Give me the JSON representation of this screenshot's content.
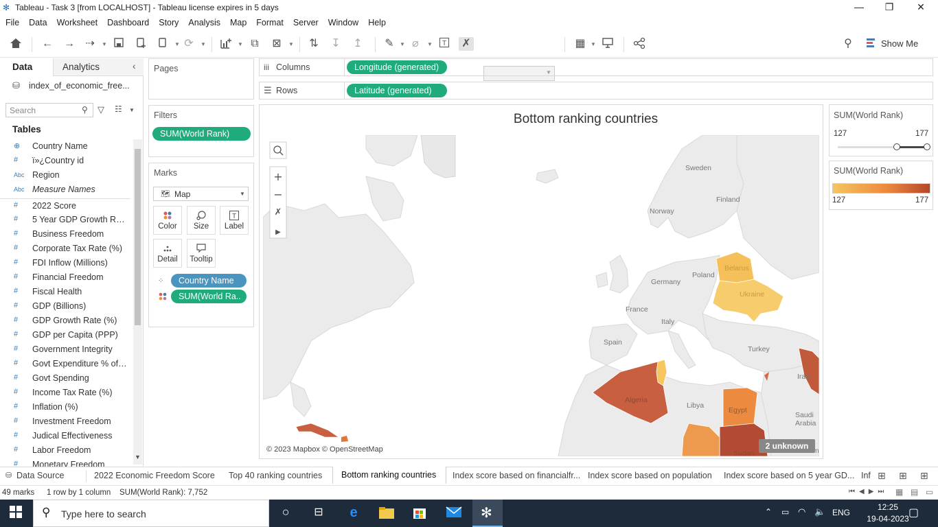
{
  "window": {
    "title": "Tableau - Task 3 [from LOCALHOST] - Tableau license expires in 5 days",
    "minimize": "—",
    "restore": "❐",
    "close": "✕"
  },
  "menu": [
    "File",
    "Data",
    "Worksheet",
    "Dashboard",
    "Story",
    "Analysis",
    "Map",
    "Format",
    "Server",
    "Window",
    "Help"
  ],
  "toolbar": {
    "show_me": "Show Me"
  },
  "left_pane": {
    "tab_data": "Data",
    "tab_analytics": "Analytics",
    "datasource": "index_of_economic_free...",
    "search_placeholder": "Search",
    "tables_heading": "Tables",
    "fields": [
      {
        "icon": "globe",
        "type": "geo",
        "name": "Country Name"
      },
      {
        "icon": "#",
        "type": "num",
        "name": "ï»¿Country id"
      },
      {
        "icon": "Abc",
        "type": "str",
        "name": "Region"
      },
      {
        "icon": "Abc",
        "type": "str",
        "name": "Measure Names",
        "italic": true
      },
      {
        "icon": "#",
        "type": "num",
        "name": "2022 Score"
      },
      {
        "icon": "#",
        "type": "num",
        "name": "5 Year GDP Growth Ra..."
      },
      {
        "icon": "#",
        "type": "num",
        "name": "Business Freedom"
      },
      {
        "icon": "#",
        "type": "num",
        "name": "Corporate Tax Rate (%)"
      },
      {
        "icon": "#",
        "type": "num",
        "name": "FDI Inflow (Millions)"
      },
      {
        "icon": "#",
        "type": "num",
        "name": "Financial Freedom"
      },
      {
        "icon": "#",
        "type": "num",
        "name": "Fiscal Health"
      },
      {
        "icon": "#",
        "type": "num",
        "name": "GDP (Billions)"
      },
      {
        "icon": "#",
        "type": "num",
        "name": "GDP Growth Rate (%)"
      },
      {
        "icon": "#",
        "type": "num",
        "name": "GDP per Capita (PPP)"
      },
      {
        "icon": "#",
        "type": "num",
        "name": "Government Integrity"
      },
      {
        "icon": "#",
        "type": "num",
        "name": "Govt Expenditure % of ..."
      },
      {
        "icon": "#",
        "type": "num",
        "name": "Govt Spending"
      },
      {
        "icon": "#",
        "type": "num",
        "name": "Income Tax Rate (%)"
      },
      {
        "icon": "#",
        "type": "num",
        "name": "Inflation (%)"
      },
      {
        "icon": "#",
        "type": "num",
        "name": "Investment Freedom"
      },
      {
        "icon": "#",
        "type": "num",
        "name": "Judical Effectiveness"
      },
      {
        "icon": "#",
        "type": "num",
        "name": "Labor Freedom"
      },
      {
        "icon": "#",
        "type": "num",
        "name": "Monetary Freedom"
      }
    ]
  },
  "shelves": {
    "pages": "Pages",
    "filters": "Filters",
    "filter_pill": "SUM(World Rank)",
    "marks": "Marks",
    "mark_type": "Map",
    "mark_buttons": [
      "Color",
      "Size",
      "Label",
      "Detail",
      "Tooltip"
    ],
    "mark_pills": [
      "Country Name",
      "SUM(World Ra.."
    ],
    "columns_label": "Columns",
    "columns_pill": "Longitude (generated)",
    "rows_label": "Rows",
    "rows_pill": "Latitude (generated)"
  },
  "view": {
    "title": "Bottom ranking countries",
    "attribution": "© 2023 Mapbox © OpenStreetMap",
    "unknown_badge": "2 unknown",
    "map_labels": [
      "Sweden",
      "Finland",
      "Norway",
      "Poland",
      "Germany",
      "France",
      "Italy",
      "Spain",
      "Turkey",
      "Iraq",
      "Libya",
      "Algeria",
      "Egypt",
      "Saudi Arabia",
      "Sudan",
      "Yeme",
      "Belarus",
      "Ukraine"
    ]
  },
  "legends": {
    "filter_title": "SUM(World Rank)",
    "filter_min": "127",
    "filter_max": "177",
    "color_title": "SUM(World Rank)",
    "color_min": "127",
    "color_max": "177",
    "color_low": "#f6c55e",
    "color_high": "#b5452a"
  },
  "sheet_tabs": {
    "data_source": "Data Source",
    "tabs": [
      "2022 Economic Freedom Score",
      "Top 40 ranking countries",
      "Bottom ranking countries",
      "Index score based on financialfr...",
      "Index score based on population",
      "Index score based on 5 year GD...",
      "Inf"
    ],
    "active": "Bottom ranking countries"
  },
  "status": {
    "marks": "49 marks",
    "rows_cols": "1 row by 1 column",
    "sum": "SUM(World Rank): 7,752"
  },
  "taskbar": {
    "search_placeholder": "Type here to search",
    "lang": "ENG",
    "time": "12:25",
    "date": "19-04-2023"
  }
}
